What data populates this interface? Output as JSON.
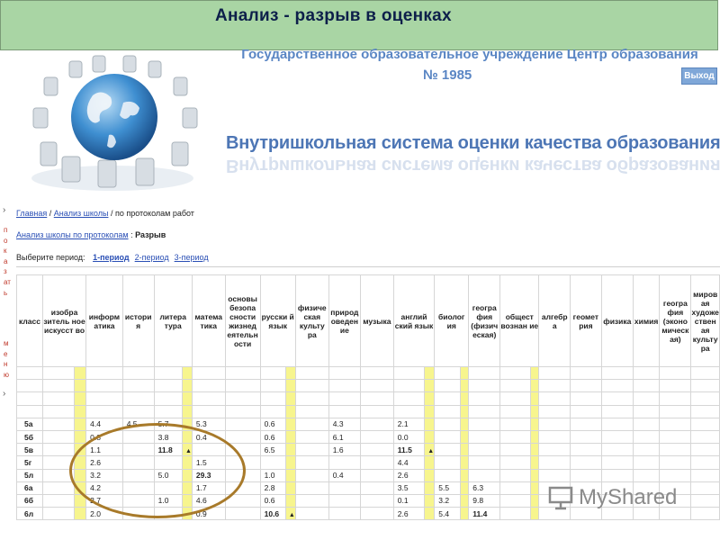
{
  "slide": {
    "title": "Анализ  - разрыв в оценках"
  },
  "header": {
    "org_line1": "Государственное образовательное учреждение Центр образования",
    "org_line2": "№ 1985",
    "exit_label": "Выход",
    "system_title": "Внутришкольная система оценки качества образования"
  },
  "side_menu": {
    "label1": "показать",
    "label2": "меню"
  },
  "breadcrumb": {
    "home": "Главная",
    "sep": " / ",
    "analysis": "Анализ школы",
    "current": " / по протоколам работ"
  },
  "protocol": {
    "link": "Анализ школы по протоколам",
    "sep": " : ",
    "mode": "Разрыв"
  },
  "period": {
    "label": "Выберите период: ",
    "options": [
      "1-период",
      "2-период",
      "3-период"
    ],
    "selected": "1-период"
  },
  "table": {
    "headers": [
      "класс",
      "изобразительное искусство",
      "информатика",
      "история",
      "литература",
      "математика",
      "основы безопасности жизнедеятельности",
      "русский язык",
      "физическая культура",
      "природоведение",
      "музыка",
      "английский язык",
      "биология",
      "география (физическая)",
      "обществознание",
      "алгебра",
      "геометрия",
      "физика",
      "химия",
      "география (экономическая)",
      "мировая художественная культура"
    ],
    "header_display": [
      "класс",
      "изобра зитель ное искусст во",
      "информ атика",
      "истори я",
      "литера тура",
      "матема тика",
      "основы безопа сности жизнед еятельн ости",
      "русски й язык",
      "физиче ская культу ра",
      "природ оведен ие",
      "музыка",
      "англий ский язык",
      "биолог ия",
      "геогра фия (физич еская)",
      "общест вознан ие",
      "алгебр а",
      "геомет рия",
      "физика",
      "химия",
      "геогра фия (эконо мическ ая)",
      "миров ая художе ствен ая культу ра"
    ],
    "rows": [
      {
        "class": "5а",
        "values": {
          "2": "4.4",
          "3": "4.5",
          "4": "5.7",
          "5": "5.3",
          "7": "0.6",
          "9": "4.3",
          "11": "2.1"
        }
      },
      {
        "class": "5б",
        "values": {
          "2": "0.8",
          "4": "3.8",
          "5": "0.4",
          "7": "0.6",
          "9": "6.1",
          "11": "0.0"
        }
      },
      {
        "class": "5в",
        "values": {
          "2": "1.1",
          "4": "11.8",
          "7": "6.5",
          "9": "1.6",
          "11": "11.5"
        },
        "flagged": [
          "4",
          "11"
        ]
      },
      {
        "class": "5г",
        "values": {
          "2": "2.6",
          "5": "1.5",
          "11": "4.4"
        }
      },
      {
        "class": "5л",
        "values": {
          "2": "3.2",
          "4": "5.0",
          "5": "29.3",
          "7": "1.0",
          "9": "0.4",
          "11": "2.6"
        },
        "flagged": [
          "5"
        ]
      },
      {
        "class": "6а",
        "values": {
          "2": "4.2",
          "5": "1.7",
          "7": "2.8",
          "11": "3.5",
          "12": "5.5",
          "13": "6.3"
        }
      },
      {
        "class": "6б",
        "values": {
          "2": "2.7",
          "4": "1.0",
          "5": "4.6",
          "7": "0.6",
          "11": "0.1",
          "12": "3.2",
          "13": "9.8"
        }
      },
      {
        "class": "6л",
        "values": {
          "2": "2.0",
          "5": "0.9",
          "7": "10.6",
          "11": "2.6",
          "12": "5.4",
          "13": "11.4"
        },
        "flagged": [
          "7",
          "13"
        ]
      }
    ],
    "flag_symbol": "▲"
  },
  "watermark": {
    "text": "MyShared"
  },
  "colors": {
    "title_bar": "#a9d5a4",
    "header_blue": "#5a86c4",
    "stripe_yellow": "#f7f58e",
    "ring": "#a87a2a"
  }
}
